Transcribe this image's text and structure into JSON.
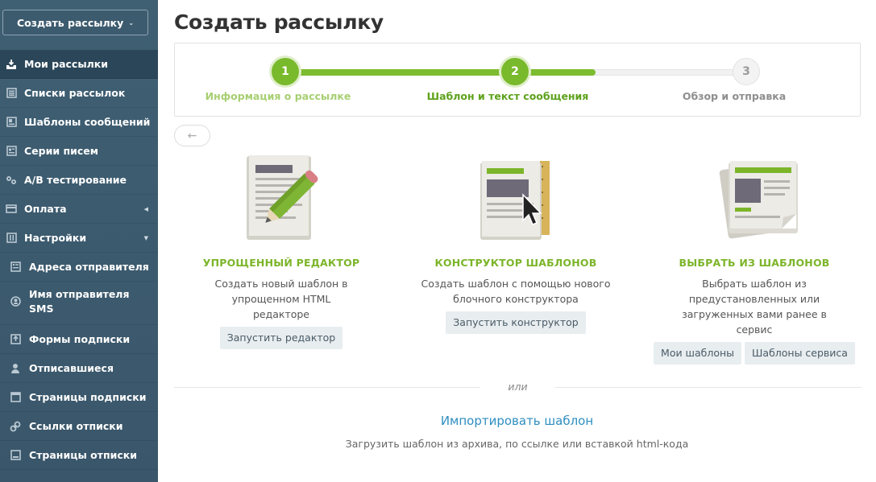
{
  "sidebar": {
    "create_button": "Создать рассылку",
    "items": [
      {
        "label": "Мои рассылки",
        "icon": "mailbox-icon",
        "active": true
      },
      {
        "label": "Списки рассылок",
        "icon": "list-icon"
      },
      {
        "label": "Шаблоны сообщений",
        "icon": "template-icon"
      },
      {
        "label": "Серии писем",
        "icon": "series-icon"
      },
      {
        "label": "A/B тестирование",
        "icon": "ab-test-icon"
      },
      {
        "label": "Оплата",
        "icon": "wallet-icon",
        "arrow": "◀"
      },
      {
        "label": "Настройки",
        "icon": "settings-icon",
        "arrow": "▼"
      }
    ],
    "subitems": [
      {
        "label": "Адреса отправителя",
        "icon": "sender-address-icon"
      },
      {
        "label": "Имя отправителя SMS",
        "icon": "sms-sender-icon"
      },
      {
        "label": "Формы подписки",
        "icon": "subscribe-form-icon"
      },
      {
        "label": "Отписавшиеся",
        "icon": "unsubscribed-icon"
      },
      {
        "label": "Страницы подписки",
        "icon": "subscribe-page-icon"
      },
      {
        "label": "Ссылки отписки",
        "icon": "unsubscribe-link-icon"
      },
      {
        "label": "Страницы отписки",
        "icon": "unsubscribe-page-icon"
      }
    ]
  },
  "main": {
    "title": "Создать рассылку",
    "steps": [
      {
        "number": "1",
        "label": "Информация о рассылке",
        "state": "done"
      },
      {
        "number": "2",
        "label": "Шаблон и текст сообщения",
        "state": "current"
      },
      {
        "number": "3",
        "label": "Обзор и отправка",
        "state": "next"
      }
    ],
    "back_button": "←",
    "options": [
      {
        "title": "УПРОЩЕННЫЙ РЕДАКТОР",
        "description": "Создать новый шаблон в упрощенном HTML редакторе",
        "buttons": [
          "Запустить редактор"
        ]
      },
      {
        "title": "КОНСТРУКТОР ШАБЛОНОВ",
        "description": "Создать шаблон с помощью нового блочного конструктора",
        "buttons": [
          "Запустить конструктор"
        ]
      },
      {
        "title": "ВЫБРАТЬ ИЗ ШАБЛОНОВ",
        "description": "Выбрать шаблон из предустановленных или загруженных вами ранее в сервис",
        "buttons": [
          "Мои шаблоны",
          "Шаблоны сервиса"
        ]
      }
    ],
    "or_text": "или",
    "import": {
      "link": "Импортировать шаблон",
      "description": "Загрузить шаблон из архива, по ссылке или вставкой html-кода"
    }
  },
  "colors": {
    "sidebar_bg": "#3f5f73",
    "sidebar_active": "#2b4658",
    "accent_green": "#7cb52a",
    "link_blue": "#2e8ec0"
  }
}
